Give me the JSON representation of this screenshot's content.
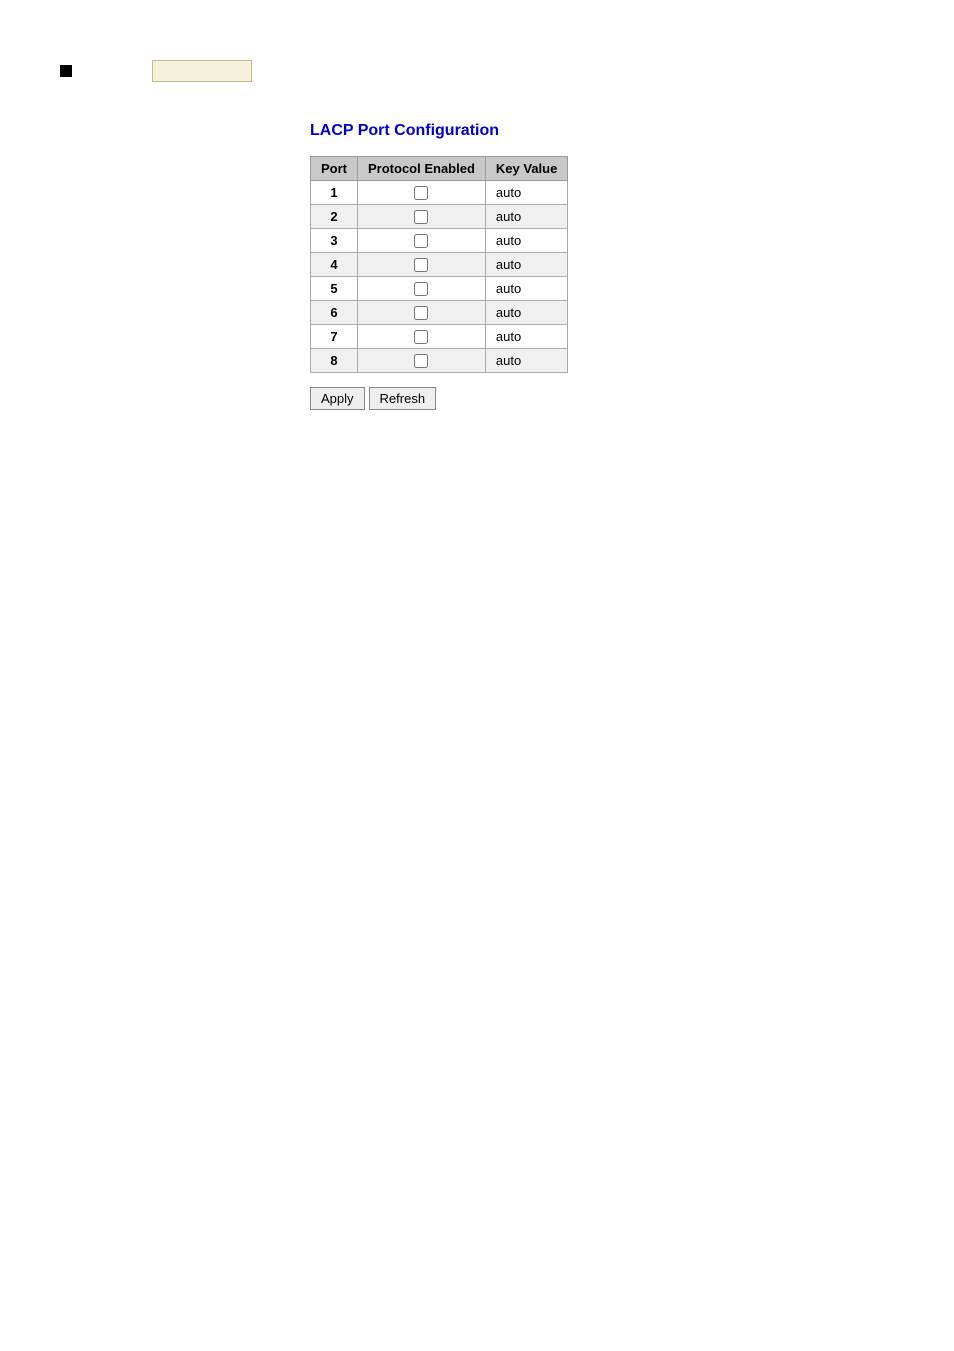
{
  "topArea": {
    "squareColor": "#000000",
    "inputValue": ""
  },
  "page": {
    "title": "LACP Port Configuration"
  },
  "table": {
    "headers": [
      "Port",
      "Protocol Enabled",
      "Key Value"
    ],
    "rows": [
      {
        "port": "1",
        "enabled": false,
        "keyValue": "auto"
      },
      {
        "port": "2",
        "enabled": false,
        "keyValue": "auto"
      },
      {
        "port": "3",
        "enabled": false,
        "keyValue": "auto"
      },
      {
        "port": "4",
        "enabled": false,
        "keyValue": "auto"
      },
      {
        "port": "5",
        "enabled": false,
        "keyValue": "auto"
      },
      {
        "port": "6",
        "enabled": false,
        "keyValue": "auto"
      },
      {
        "port": "7",
        "enabled": false,
        "keyValue": "auto"
      },
      {
        "port": "8",
        "enabled": false,
        "keyValue": "auto"
      }
    ]
  },
  "buttons": {
    "apply": "Apply",
    "refresh": "Refresh"
  }
}
